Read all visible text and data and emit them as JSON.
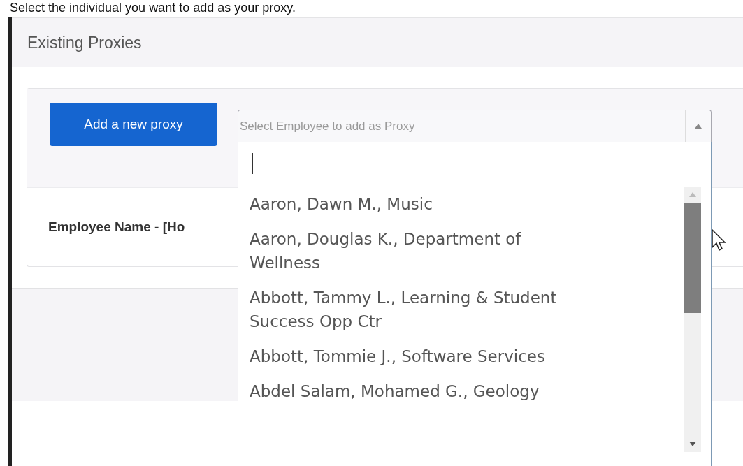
{
  "instruction": "Select the individual you want to add as your proxy.",
  "panel": {
    "title": "Existing Proxies"
  },
  "card": {
    "add_button": "Add a new proxy",
    "column_label": "Employee Name - [Ho"
  },
  "employee_select": {
    "placeholder": "Select Employee to add as Proxy",
    "expanded": true,
    "options": [
      {
        "label": "Aaron, Dawn M., Music",
        "selected": false
      },
      {
        "label": "Aaron, Douglas K., Department of Wellness",
        "selected": false
      },
      {
        "label": "Abbott, Tammy L., Learning & Student Success Opp Ctr",
        "selected": false
      },
      {
        "label": "Abbott, Tommie J., Software Services",
        "selected": false
      },
      {
        "label": "Abdel Salam, Mohamed G., Geology",
        "selected": false
      }
    ]
  }
}
